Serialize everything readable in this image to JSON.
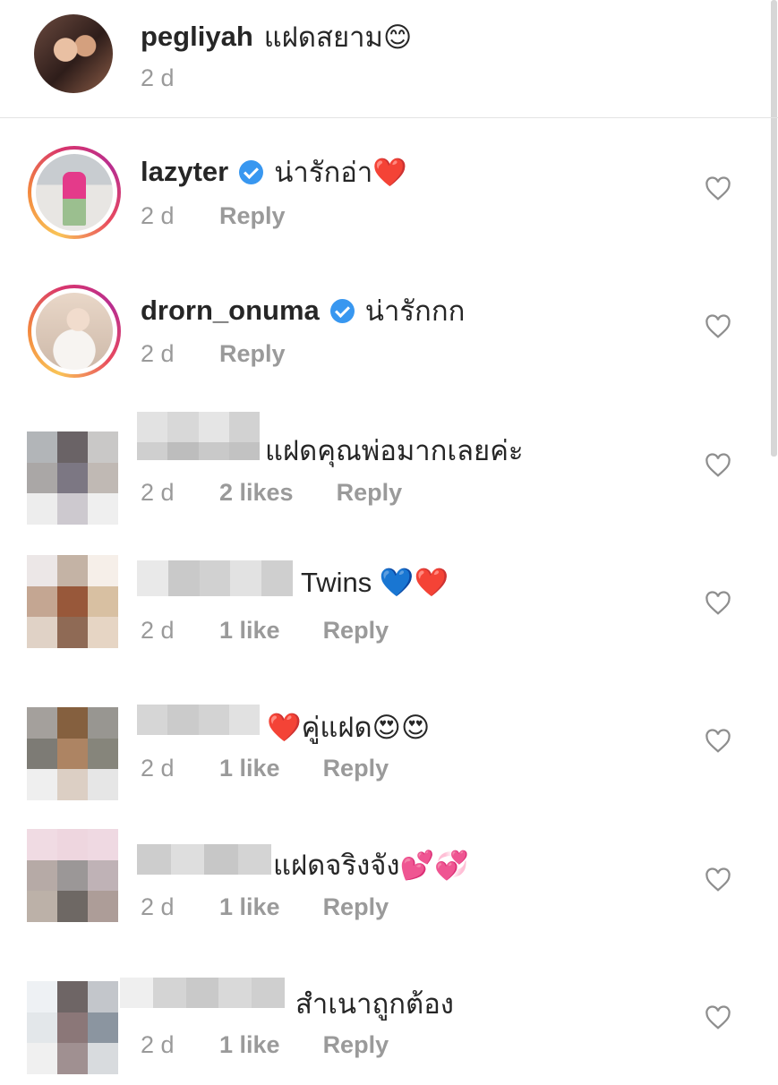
{
  "comments": [
    {
      "username": "pegliyah",
      "text": "แฝดสยาม",
      "emoji": "😊",
      "time": "2 d"
    },
    {
      "username": "lazyter",
      "verified": true,
      "text": "น่ารักอ่า",
      "emoji": "❤️",
      "time": "2 d",
      "reply": "Reply"
    },
    {
      "username": "drorn_onuma",
      "verified": true,
      "text": "น่ารักกก",
      "time": "2 d",
      "reply": "Reply"
    },
    {
      "text": "แฝดคุณพ่อมากเลยค่ะ",
      "time": "2 d",
      "likes": "2 likes",
      "reply": "Reply"
    },
    {
      "text": "Twins",
      "emoji": "💙❤️",
      "time": "2 d",
      "likes": "1 like",
      "reply": "Reply"
    },
    {
      "text": "คู่แฝด",
      "emoji_before": "❤️",
      "emoji": "😍😍",
      "time": "2 d",
      "likes": "1 like",
      "reply": "Reply"
    },
    {
      "text": "แฝดจริงจัง",
      "emoji": "💕💞",
      "time": "2 d",
      "likes": "1 like",
      "reply": "Reply"
    },
    {
      "text": "สำเนาถูกต้อง",
      "time": "2 d",
      "likes": "1 like",
      "reply": "Reply"
    }
  ],
  "icons": {
    "like": "heart-outline-icon",
    "verified": "verified-badge-icon"
  },
  "colors": {
    "text": "#262626",
    "meta": "#9a9a9a",
    "verified": "#3897f0"
  }
}
